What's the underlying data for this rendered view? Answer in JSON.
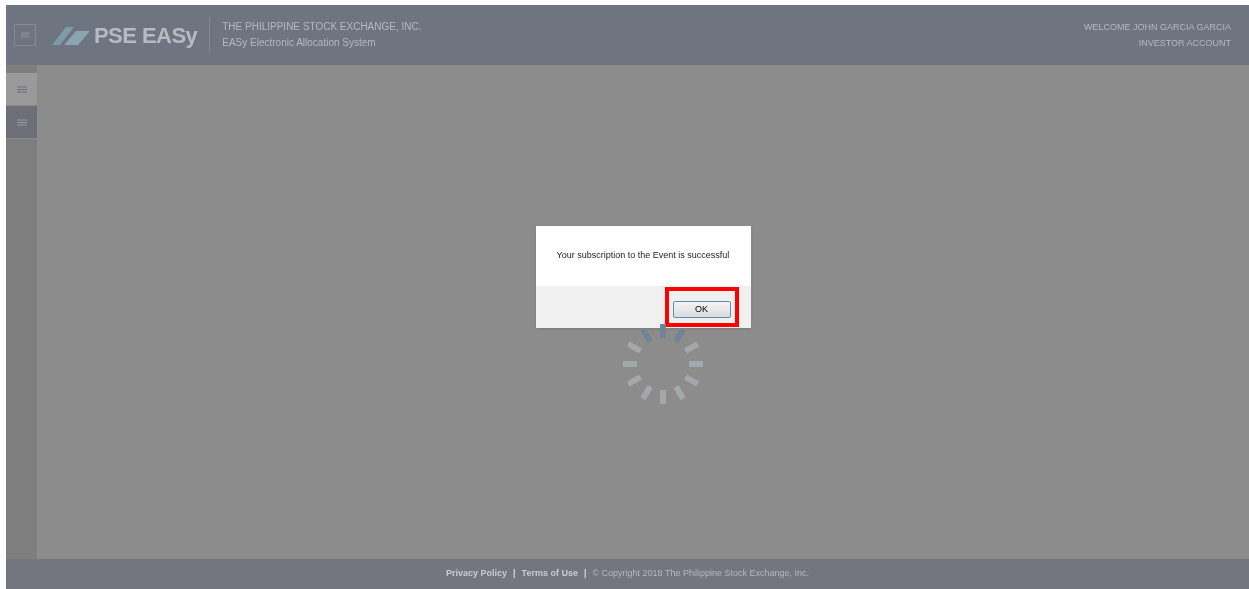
{
  "header": {
    "logo_text": "PSE EASy",
    "org_name": "THE PHILIPPINE STOCK EXCHANGE, INC.",
    "system_name": "EASy Electronic Allocation System",
    "welcome": "WELCOME JOHN GARCIA GARCIA",
    "account": "INVESTOR ACCOUNT"
  },
  "sidebar": {
    "items": [
      {
        "selected": true
      },
      {
        "selected": false
      }
    ]
  },
  "dialog": {
    "message": "Your subscription to the Event is successful",
    "button": "OK",
    "highlighted": true
  },
  "footer": {
    "items": [
      {
        "kind": "link",
        "text": "Privacy Policy"
      },
      {
        "kind": "separator",
        "text": "|"
      },
      {
        "kind": "link",
        "text": "Terms of Use"
      },
      {
        "kind": "separator",
        "text": "|"
      },
      {
        "kind": "text",
        "text": "© Copyright 2018 The Philippine Stock Exchange, Inc."
      }
    ]
  }
}
